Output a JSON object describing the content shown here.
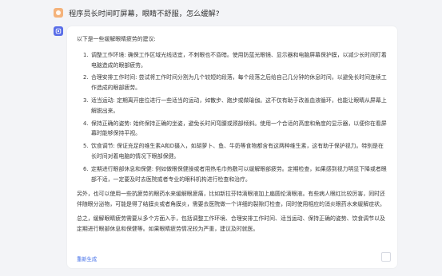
{
  "user": {
    "question": "程序员长时间盯屏幕，眼睛不舒服，怎么缓解?"
  },
  "assistant": {
    "intro": "以下是一些缓解眼睛疲劳的建议:",
    "items": [
      {
        "num": "1.",
        "text": "调整工作环境: 确保工作区域光线适宜，不刺眼也不昏暗。使用防蓝光眼镜、显示器和电脑屏幕保护膜，以减少长时间盯着电脑造成的眼部疲劳。"
      },
      {
        "num": "2.",
        "text": "合理安排工作时间: 尝试将工作时间分割为几个较短的段落，每个段落之后给自己几分钟的休息时间，以避免长时间连续工作造成的眼部疲劳。"
      },
      {
        "num": "3.",
        "text": "适当运动: 定期离开座位进行一些适当的运动，如散步、跑步或做瑜伽。这不仅有助于改善血液循环，也能让眼睛从屏幕上解脱出来。"
      },
      {
        "num": "4.",
        "text": "保持正确的姿势: 始终保持正确的坐姿，避免长时间弯腰或颈部倾斜。使用一个合适的高度和角度的显示器，以便你在看屏幕时能够保持平视。"
      },
      {
        "num": "5.",
        "text": "饮食调节: 保证充足的维生素A和D摄入，如胡萝卜、鱼、牛奶等食物都含有这两种维生素，这有助于保护视力。特别是在长时间对着电脑的情况下眼部保健。"
      },
      {
        "num": "6.",
        "text": "定期进行眼部休息和保健: 例如做眼保健操或者用热毛巾热敷可以缓解眼部疲劳。定期检查，如果感到视力明显下降或者眼部不适，一定要及时去医院或者专业的眼科机构进行检查和治疗。"
      }
    ],
    "para1": "另外，也可以使用一些抗疲劳的眼药水来缓解眼疲痛，比如新拉芬特滴眼液加上扁圆伦滴眼液。有些病人眼红比较厉害，同时还伴随眼分泌物，可能是得了结膜炎或者角膜炎，需要去医院做一个详细的裂隙灯检查，同时使用相应的消炎眼药水来缓解症状。",
    "para2": "总之，缓解眼睛疲劳需要从多个方面入手，包括调整工作环境、合理安排工作时间、适当运动、保持正确的姿势、饮食调节以及定期进行眼部休息和保健等。如果眼睛疲劳情况较为严重，建议及时就医。",
    "regenerate": "重新生成"
  }
}
